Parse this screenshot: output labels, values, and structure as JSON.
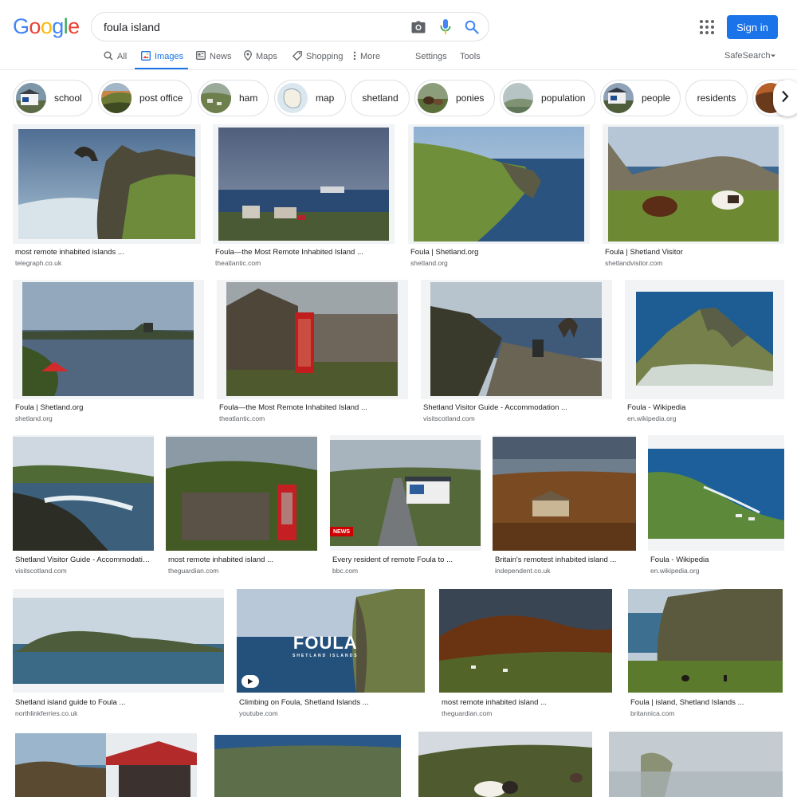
{
  "logo": {
    "letters": [
      "G",
      "o",
      "o",
      "g",
      "l",
      "e"
    ],
    "colors": [
      "#4285f4",
      "#ea4335",
      "#fbbc05",
      "#4285f4",
      "#34a853",
      "#ea4335"
    ]
  },
  "search": {
    "value": "foula island",
    "placeholder": ""
  },
  "header": {
    "signin_label": "Sign in",
    "accent": "#1a73e8"
  },
  "tabs": [
    {
      "label": "All",
      "icon": "search-icon",
      "active": false
    },
    {
      "label": "Images",
      "icon": "image-icon",
      "active": true
    },
    {
      "label": "News",
      "icon": "news-icon",
      "active": false
    },
    {
      "label": "Maps",
      "icon": "map-pin-icon",
      "active": false
    },
    {
      "label": "Shopping",
      "icon": "tag-icon",
      "active": false
    },
    {
      "label": "More",
      "icon": "more-vert-icon",
      "active": false
    }
  ],
  "tools": {
    "settings": "Settings",
    "tools": "Tools",
    "safesearch": "SafeSearch"
  },
  "chips": [
    {
      "label": "school",
      "thumb": true
    },
    {
      "label": "post office",
      "thumb": true
    },
    {
      "label": "ham",
      "thumb": true
    },
    {
      "label": "map",
      "thumb": true
    },
    {
      "label": "shetland",
      "thumb": false
    },
    {
      "label": "ponies",
      "thumb": true
    },
    {
      "label": "population",
      "thumb": true
    },
    {
      "label": "people",
      "thumb": true
    },
    {
      "label": "residents",
      "thumb": false
    }
  ],
  "results": [
    {
      "title": "most remote inhabited islands ...",
      "source": "telegraph.co.uk"
    },
    {
      "title": "Foula—the Most Remote Inhabited Island ...",
      "source": "theatlantic.com"
    },
    {
      "title": "Foula | Shetland.org",
      "source": "shetland.org"
    },
    {
      "title": "Foula | Shetland Visitor",
      "source": "shetlandvisitor.com"
    },
    {
      "title": "Foula | Shetland.org",
      "source": "shetland.org"
    },
    {
      "title": "Foula—the Most Remote Inhabited Island ...",
      "source": "theatlantic.com"
    },
    {
      "title": "Shetland Visitor Guide - Accommodation ...",
      "source": "visitscotland.com"
    },
    {
      "title": "Foula - Wikipedia",
      "source": "en.wikipedia.org"
    },
    {
      "title": "Shetland Visitor Guide - Accommodation ...",
      "source": "visitscotland.com"
    },
    {
      "title": "most remote inhabited island ...",
      "source": "theguardian.com"
    },
    {
      "title": "Every resident of remote Foula to ...",
      "source": "bbc.com"
    },
    {
      "title": "Britain's remotest inhabited island ...",
      "source": "independent.co.uk"
    },
    {
      "title": "Foula - Wikipedia",
      "source": "en.wikipedia.org"
    },
    {
      "title": "Shetland island guide to Foula ...",
      "source": "northlinkferries.co.uk"
    },
    {
      "title": "Climbing on Foula, Shetland Islands ...",
      "source": "youtube.com"
    },
    {
      "title": "most remote inhabited island ...",
      "source": "theguardian.com"
    },
    {
      "title": "Foula | island, Shetland Islands ...",
      "source": "britannica.com"
    }
  ],
  "overlays": {
    "bbc_badge": "NEWS",
    "foula_title": "FOULA",
    "foula_subtitle": "SHETLAND ISLANDS"
  }
}
